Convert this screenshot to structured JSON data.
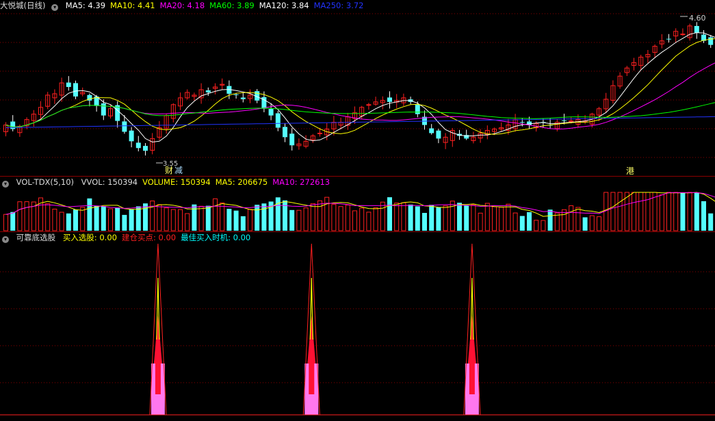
{
  "stock": {
    "name": "大悦城",
    "period": "(日线)"
  },
  "price_panel": {
    "indicators": [
      {
        "label": "MA5: 4.39",
        "color": "#ffffff"
      },
      {
        "label": "MA10: 4.41",
        "color": "#ffff00"
      },
      {
        "label": "MA20: 4.18",
        "color": "#ff00ff"
      },
      {
        "label": "MA60: 3.89",
        "color": "#00ff00"
      },
      {
        "label": "MA120: 3.84",
        "color": "#ffffff"
      },
      {
        "label": "MA250: 3.72",
        "color": "#2233ff"
      }
    ],
    "high_label": "4.60",
    "low_label": "3.55",
    "markers": {
      "cai": "财",
      "xie": "减",
      "gang": "港"
    }
  },
  "volume_panel": {
    "title": "VOL-TDX(5,10)",
    "indicators": [
      {
        "label": "VVOL: 150394",
        "color": "#dddddd"
      },
      {
        "label": "VOLUME: 150394",
        "color": "#ffff00"
      },
      {
        "label": "MA5: 206675",
        "color": "#ffff00"
      },
      {
        "label": "MA10: 272613",
        "color": "#ff00ff"
      }
    ]
  },
  "signal_panel": {
    "title": "可靠底选股",
    "indicators": [
      {
        "label": "买入选股: 0.00",
        "color": "#ffff00"
      },
      {
        "label": "建仓买点: 0.00",
        "color": "#ff2020"
      },
      {
        "label": "最佳买入时机: 0.00",
        "color": "#00ffff"
      }
    ]
  },
  "colors": {
    "up": "#ff2020",
    "down": "#54ffff",
    "grid": "#8b0000"
  },
  "chart_data": {
    "type": "candlestick",
    "closes": [
      3.82,
      3.79,
      3.81,
      3.86,
      3.9,
      3.95,
      4.04,
      4.05,
      4.13,
      4.1,
      4.03,
      4.06,
      4.0,
      3.96,
      3.89,
      3.94,
      3.85,
      3.77,
      3.7,
      3.65,
      3.63,
      3.72,
      3.8,
      3.89,
      3.97,
      4.02,
      4.06,
      4.04,
      4.08,
      4.06,
      4.1,
      4.12,
      4.05,
      4.04,
      4.01,
      4.04,
      4.0,
      3.94,
      3.89,
      3.8,
      3.73,
      3.67,
      3.68,
      3.7,
      3.74,
      3.76,
      3.79,
      3.84,
      3.84,
      3.88,
      3.91,
      3.95,
      3.97,
      3.99,
      4.0,
      3.99,
      4.0,
      4.02,
      3.99,
      3.9,
      3.82,
      3.76,
      3.72,
      3.73,
      3.78,
      3.74,
      3.72,
      3.73,
      3.76,
      3.78,
      3.79,
      3.8,
      3.82,
      3.86,
      3.84,
      3.82,
      3.83,
      3.84,
      3.82,
      3.84,
      3.85,
      3.85,
      3.86,
      3.85,
      3.9,
      3.94,
      4.01,
      4.11,
      4.18,
      4.24,
      4.28,
      4.32,
      4.34,
      4.4,
      4.44,
      4.45,
      4.51,
      4.49,
      4.55,
      4.5,
      4.44,
      4.41,
      4.39
    ],
    "volume_ma5": 206675,
    "volume_ma10": 272613,
    "last_volume": 150394,
    "signal_peaks_at_bar": [
      22,
      44,
      67
    ]
  }
}
